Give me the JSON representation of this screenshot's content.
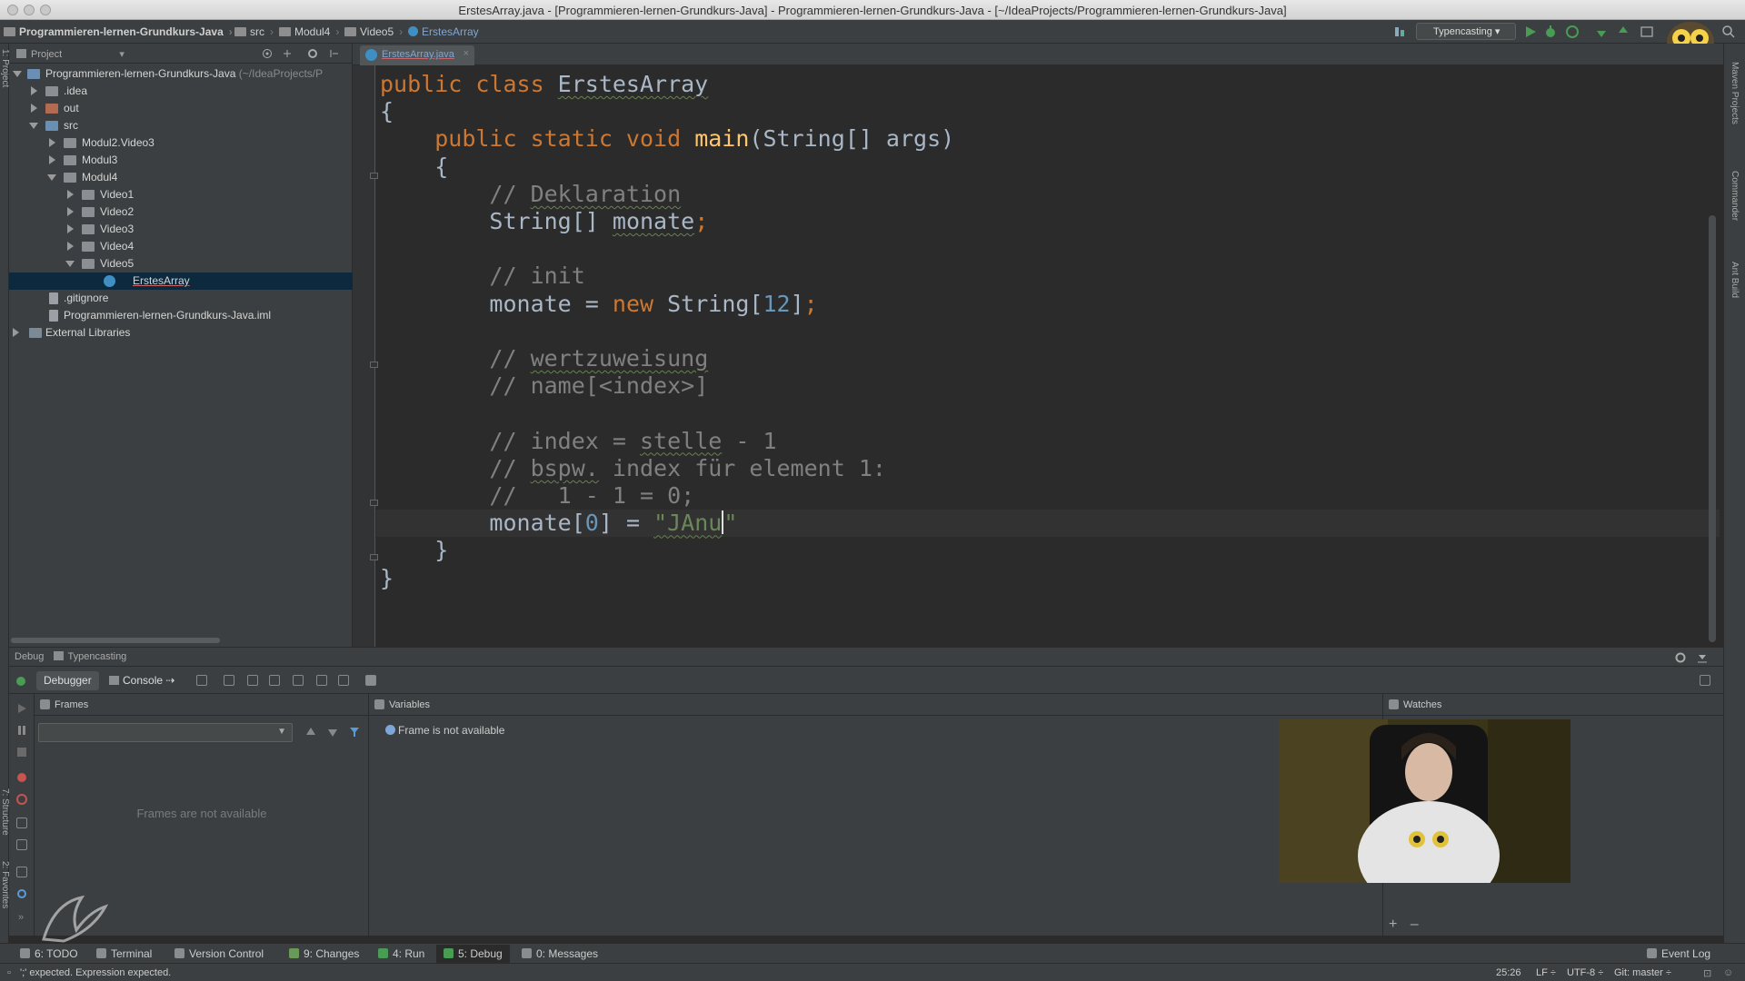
{
  "window": {
    "title": "ErstesArray.java - [Programmieren-lernen-Grundkurs-Java] - Programmieren-lernen-Grundkurs-Java - [~/IdeaProjects/Programmieren-lernen-Grundkurs-Java]"
  },
  "navbar": {
    "crumbs": [
      "Programmieren-lernen-Grundkurs-Java",
      "src",
      "Modul4",
      "Video5",
      "ErstesArray"
    ],
    "run_config": "Typencasting"
  },
  "project_panel": {
    "title": "Project",
    "tree": [
      {
        "label": "Programmieren-lernen-Grundkurs-Java",
        "path": "(~/IdeaProjects/P"
      },
      {
        "label": ".idea"
      },
      {
        "label": "out"
      },
      {
        "label": "src"
      },
      {
        "label": "Modul2.Video3"
      },
      {
        "label": "Modul3"
      },
      {
        "label": "Modul4"
      },
      {
        "label": "Video1"
      },
      {
        "label": "Video2"
      },
      {
        "label": "Video3"
      },
      {
        "label": "Video4"
      },
      {
        "label": "Video5"
      },
      {
        "label": "ErstesArray"
      },
      {
        "label": ".gitignore"
      },
      {
        "label": "Programmieren-lernen-Grundkurs-Java.iml"
      },
      {
        "label": "External Libraries"
      }
    ]
  },
  "editor": {
    "tab": "ErstesArray.java",
    "lines": {
      "l1_kw": "public class ",
      "l1_name": "ErstesArray",
      "l2": "{",
      "l3_kw": "public static void ",
      "l3_fn": "main",
      "l3_rest": "(String[] args)",
      "l4": "{",
      "l5_a": "// ",
      "l5_b": "Deklaration",
      "l6_a": "String[] ",
      "l6_b": "monate",
      "l6_c": ";",
      "l8": "// init",
      "l9_a": "monate = ",
      "l9_kw": "new ",
      "l9_b": "String[",
      "l9_n": "12",
      "l9_c": "]",
      "l9_d": ";",
      "l11_a": "// ",
      "l11_b": "wertzuweisung",
      "l12": "// name[<index>]",
      "l14_a": "// index = ",
      "l14_b": "stelle",
      "l14_c": " - 1",
      "l15_a": "// ",
      "l15_b": "bspw.",
      "l15_c": " index für element 1:",
      "l16": "//   1 - 1 = 0;",
      "l17_a": "monate[",
      "l17_n": "0",
      "l17_b": "] = ",
      "l17_s": "\"JAnu",
      "l17_s2": "\"",
      "l18": "}",
      "l19": "}"
    }
  },
  "debug": {
    "header": "Debug",
    "config": "Typencasting",
    "tabs": [
      "Debugger",
      "Console"
    ],
    "frames": {
      "title": "Frames",
      "empty": "Frames are not available"
    },
    "variables": {
      "title": "Variables",
      "message": "Frame is not available"
    },
    "watches": {
      "title": "Watches",
      "add": "+",
      "remove": "–"
    }
  },
  "toolstripe": [
    "6: TODO",
    "Terminal",
    "Version Control",
    "9: Changes",
    "4: Run",
    "5: Debug",
    "0: Messages",
    "Event Log"
  ],
  "status": {
    "message": "';' expected. Expression expected.",
    "position": "25:26",
    "line_sep": "LF ÷",
    "encoding": "UTF-8 ÷",
    "git": "Git: master ÷"
  },
  "colors": {
    "keyword": "#cc7832",
    "comment": "#808080",
    "number": "#6897bb",
    "string": "#6a8759",
    "function": "#ffc66d",
    "selection": "#0d293e"
  }
}
